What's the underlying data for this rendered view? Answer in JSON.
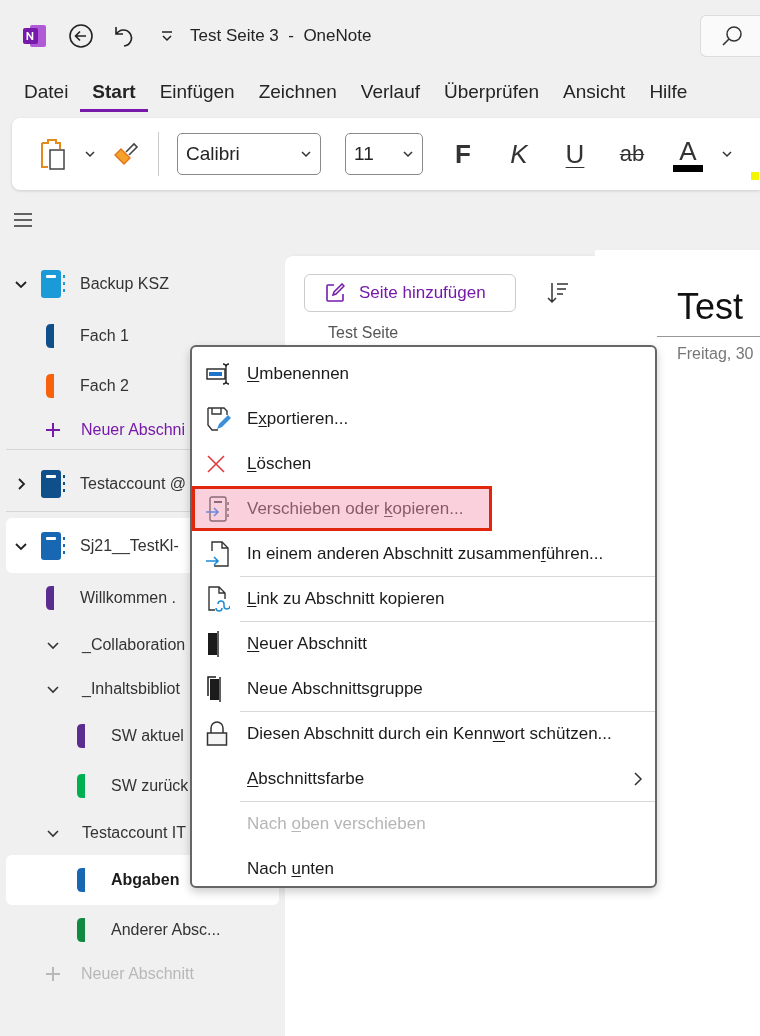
{
  "window": {
    "title": "Test Seite 3  -  OneNote"
  },
  "ribbon_tabs": [
    {
      "label": "Datei",
      "selected": false
    },
    {
      "label": "Start",
      "selected": true
    },
    {
      "label": "Einfügen",
      "selected": false
    },
    {
      "label": "Zeichnen",
      "selected": false
    },
    {
      "label": "Verlauf",
      "selected": false
    },
    {
      "label": "Überprüfen",
      "selected": false
    },
    {
      "label": "Ansicht",
      "selected": false
    },
    {
      "label": "Hilfe",
      "selected": false
    }
  ],
  "toolbar": {
    "font": "Calibri",
    "font_size": "11",
    "bold": "F",
    "italic": "K",
    "underline": "U",
    "strikethrough": "ab",
    "font_color": "A"
  },
  "sidebar": {
    "notebooks": [
      {
        "kind": "notebook",
        "name": "Backup KSZ",
        "color": "#1a9bd7",
        "expanded": true,
        "selected": false,
        "children": [
          {
            "kind": "section",
            "name": "Fach 1",
            "color": "#0f4f8a",
            "selected": false
          },
          {
            "kind": "section",
            "name": "Fach 2",
            "color": "#f7630c",
            "selected": false
          },
          {
            "kind": "new_section",
            "name": "Neuer Abschni",
            "disabled": false
          }
        ]
      },
      {
        "kind": "notebook",
        "name": "Testaccount @",
        "color": "#0f4f8a",
        "expanded": false,
        "selected": false
      },
      {
        "kind": "notebook",
        "name": "Sj21__TestKl-",
        "color": "#1767b3",
        "expanded": true,
        "selected": true,
        "children": [
          {
            "kind": "section",
            "name": "Willkommen .",
            "color": "#5c2d91",
            "selected": false
          },
          {
            "kind": "group",
            "name": "_Collaboration",
            "expanded": true
          },
          {
            "kind": "group",
            "name": "_Inhaltsbibliot",
            "expanded": true,
            "children": [
              {
                "kind": "section",
                "name": "SW aktuel",
                "color": "#5c2d91",
                "selected": false
              },
              {
                "kind": "section",
                "name": "SW zurück",
                "color": "#00b050",
                "selected": false
              }
            ]
          },
          {
            "kind": "group",
            "name": "Testaccount IT",
            "expanded": true,
            "children": [
              {
                "kind": "section",
                "name": "Abgaben",
                "color": "#1767b3",
                "selected": true
              },
              {
                "kind": "section",
                "name": "Anderer Absc...",
                "color": "#108a3e",
                "selected": false
              }
            ]
          },
          {
            "kind": "new_section",
            "name": "Neuer Abschnitt",
            "disabled": true
          }
        ]
      }
    ]
  },
  "page_list": {
    "add_button": "Seite hinzufügen",
    "pages": [
      {
        "title": "Test Seite"
      }
    ]
  },
  "page": {
    "title": "Test",
    "date": "Freitag, 30"
  },
  "context_menu": {
    "items": [
      {
        "key": "U",
        "after": "mbenennen",
        "separator_above": false,
        "disabled": false,
        "highlighted": false,
        "submenu": false
      },
      {
        "before": "E",
        "key": "x",
        "after": "portieren...",
        "separator_above": false,
        "disabled": false,
        "highlighted": false,
        "submenu": false
      },
      {
        "key": "L",
        "after": "öschen",
        "separator_above": false,
        "disabled": false,
        "highlighted": false,
        "submenu": false
      },
      {
        "before": "Verschieben oder ",
        "key": "k",
        "after": "opieren...",
        "separator_above": false,
        "disabled": false,
        "highlighted": true,
        "submenu": false
      },
      {
        "before": "In einem anderen Abschnitt zusammen",
        "key": "f",
        "after": "ühren...",
        "separator_above": false,
        "disabled": false,
        "highlighted": false,
        "submenu": false
      },
      {
        "key": "L",
        "after": "ink zu Abschnitt kopieren",
        "separator_above": true,
        "disabled": false,
        "highlighted": false,
        "submenu": false
      },
      {
        "key": "N",
        "after": "euer Abschnitt",
        "separator_above": true,
        "disabled": false,
        "highlighted": false,
        "submenu": false
      },
      {
        "before": "Neue Abschnitts",
        "key": "g",
        "after": "ruppe",
        "separator_above": false,
        "disabled": false,
        "highlighted": false,
        "submenu": false
      },
      {
        "before": "Diesen Abschnitt durch ein Kenn",
        "key": "w",
        "after": "ort schützen...",
        "separator_above": true,
        "disabled": false,
        "highlighted": false,
        "submenu": false
      },
      {
        "key": "A",
        "after": "bschnittsfarbe",
        "separator_above": false,
        "disabled": false,
        "highlighted": false,
        "submenu": true
      },
      {
        "before": "Nach ",
        "key": "o",
        "after": "ben verschieben",
        "separator_above": true,
        "disabled": true,
        "highlighted": false,
        "submenu": false
      },
      {
        "before": "Nach ",
        "key": "u",
        "after": "nten",
        "separator_above": false,
        "disabled": false,
        "highlighted": false,
        "submenu": false
      }
    ]
  }
}
